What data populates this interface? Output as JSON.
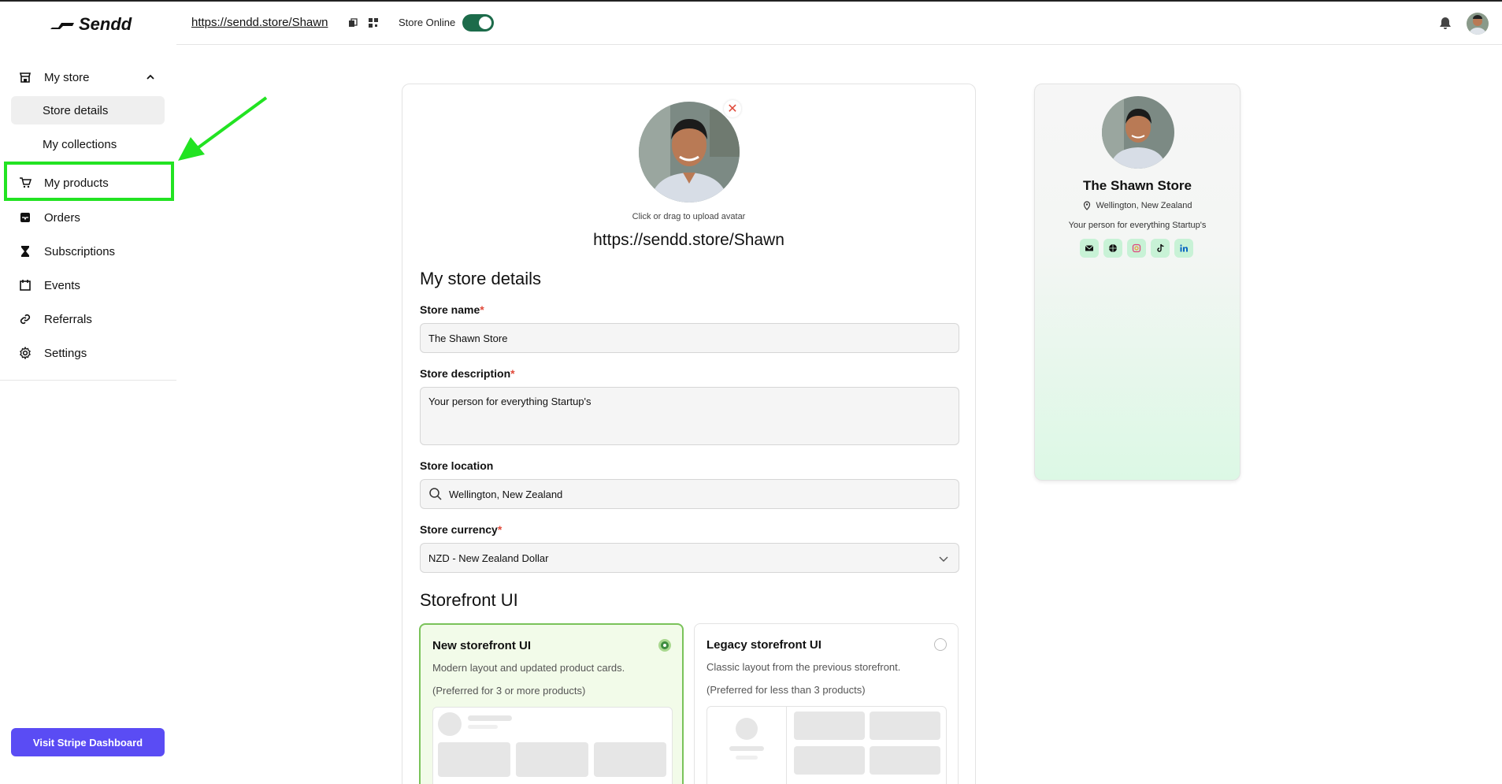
{
  "app": {
    "logo_text": "Sendd"
  },
  "header": {
    "store_url": "https://sendd.store/Shawn",
    "online_label": "Store Online",
    "online": true
  },
  "sidebar": {
    "section": {
      "label": "My store",
      "expanded": true
    },
    "sub_items": [
      {
        "label": "Store details",
        "active": true
      },
      {
        "label": "My collections",
        "active": false
      }
    ],
    "items": [
      {
        "label": "My products",
        "icon": "cart-icon"
      },
      {
        "label": "Orders",
        "icon": "inbox-icon"
      },
      {
        "label": "Subscriptions",
        "icon": "hourglass-icon"
      },
      {
        "label": "Events",
        "icon": "calendar-icon"
      },
      {
        "label": "Referrals",
        "icon": "link-icon"
      },
      {
        "label": "Settings",
        "icon": "gear-icon"
      }
    ],
    "stripe_button": "Visit Stripe Dashboard"
  },
  "form": {
    "upload_hint": "Click or drag to upload avatar",
    "url": "https://sendd.store/Shawn",
    "title": "My store details",
    "store_name": {
      "label": "Store name",
      "required": "*",
      "value": "The Shawn Store"
    },
    "store_description": {
      "label": "Store description",
      "required": "*",
      "value": "Your person for everything Startup's"
    },
    "store_location": {
      "label": "Store location",
      "value": "Wellington, New Zealand"
    },
    "store_currency": {
      "label": "Store currency",
      "required": "*",
      "value": "NZD - New Zealand Dollar"
    },
    "storefront_title": "Storefront UI",
    "options": [
      {
        "title": "New storefront UI",
        "desc": "Modern layout and updated product cards.",
        "pref": "(Preferred for 3 or more products)",
        "selected": true
      },
      {
        "title": "Legacy storefront UI",
        "desc": "Classic layout from the previous storefront.",
        "pref": "(Preferred for less than 3 products)",
        "selected": false
      }
    ]
  },
  "preview": {
    "name": "The Shawn Store",
    "location": "Wellington, New Zealand",
    "description": "Your person for everything Startup's",
    "socials": [
      "mail-icon",
      "globe-icon",
      "instagram-icon",
      "tiktok-icon",
      "linkedin-icon"
    ]
  },
  "colors": {
    "accent": "#5a4cf4",
    "toggle": "#1c6b4a",
    "highlight": "#22e322",
    "selected_border": "#7ac35a"
  }
}
